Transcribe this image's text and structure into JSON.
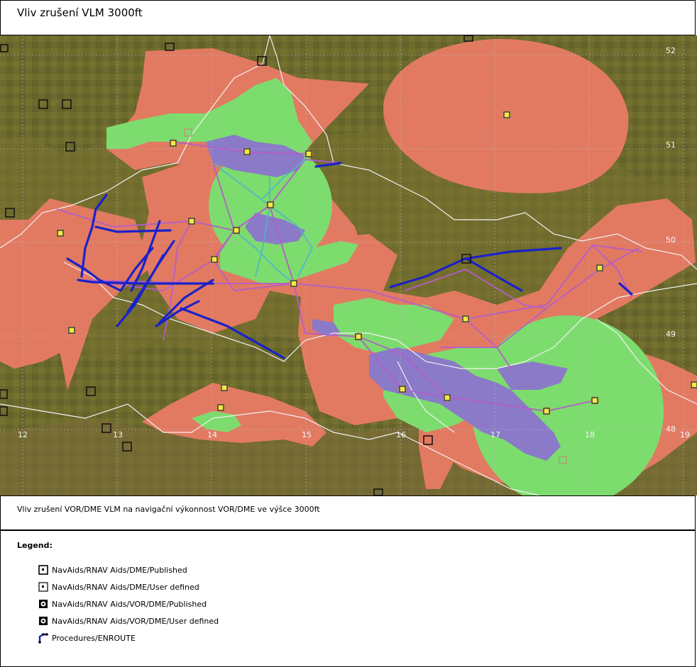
{
  "title": "Vliv zrušení VLM 3000ft",
  "caption": "Vliv zrušení VOR/DME VLM na navigační výkonnost VOR/DME ve výšce 3000ft",
  "legend": {
    "heading": "Legend:",
    "items": [
      {
        "label": "NavAids/RNAV Aids/DME/Published",
        "icon": "dme-published-icon"
      },
      {
        "label": "NavAids/RNAV Aids/DME/User defined",
        "icon": "dme-user-defined-icon"
      },
      {
        "label": "NavAids/RNAV Aids/VOR/DME/Published",
        "icon": "vor-dme-published-icon"
      },
      {
        "label": "NavAids/RNAV Aids/VOR/DME/User defined",
        "icon": "vor-dme-user-defined-icon"
      },
      {
        "label": "Procedures/ENROUTE",
        "icon": "enroute-procedure-icon"
      }
    ]
  },
  "map": {
    "longitude_labels": [
      "12",
      "13",
      "14",
      "15",
      "16",
      "17",
      "18",
      "19"
    ],
    "latitude_labels": [
      "52",
      "51",
      "50",
      "49",
      "48"
    ],
    "colors": {
      "terrain": "#6f6a2c",
      "coverage_red": "#e27a62",
      "coverage_green": "#7ddc6e",
      "coverage_blue": "#8a7ac8",
      "enroute": "#1a22c8",
      "route_purple": "#b45ec8",
      "border": "#f2f2f2"
    }
  }
}
